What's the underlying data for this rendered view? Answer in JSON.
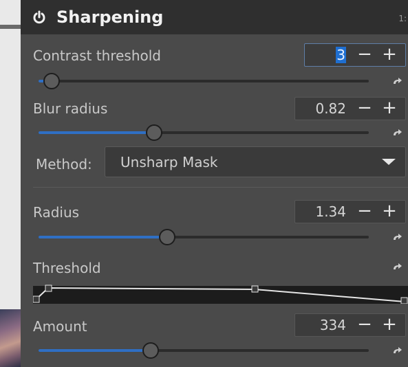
{
  "panel": {
    "title": "Sharpening",
    "corner_text": "1:",
    "icons": {
      "power": "power-icon",
      "reset": "reset-arrow-icon",
      "dropdown": "chevron-down-icon"
    }
  },
  "contrast_threshold": {
    "label": "Contrast threshold",
    "value": "3",
    "minus": "−",
    "plus": "+",
    "slider_fraction": 0.04
  },
  "blur_radius": {
    "label": "Blur radius",
    "value": "0.82",
    "minus": "−",
    "plus": "+",
    "slider_fraction": 0.35
  },
  "method": {
    "label": "Method:",
    "value": "Unsharp Mask"
  },
  "radius": {
    "label": "Radius",
    "value": "1.34",
    "minus": "−",
    "plus": "+",
    "slider_fraction": 0.39
  },
  "threshold": {
    "label": "Threshold"
  },
  "amount": {
    "label": "Amount",
    "value": "334",
    "minus": "−",
    "plus": "+",
    "slider_fraction": 0.34
  },
  "colors": {
    "accent": "#2f6fc4",
    "panel": "#4a4a4a",
    "header": "#2f2f2f",
    "selection": "#1f6fd1"
  }
}
